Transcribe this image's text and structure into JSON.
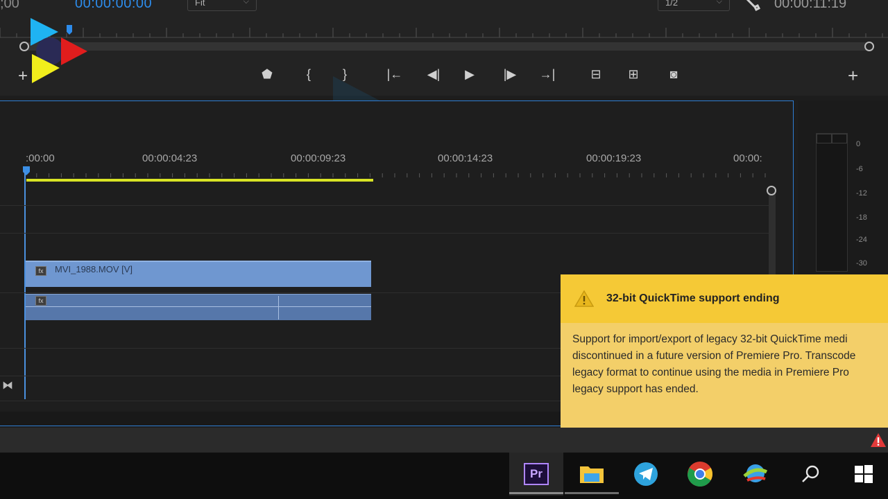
{
  "monitor": {
    "timecode_left": ";00",
    "timecode_current": "00:00:00:00",
    "fit_select": "Fit",
    "resolution_select": "1/2",
    "timecode_duration": "00:00:11:19",
    "transport_icons": [
      "add-marker-icon",
      "mark-in-icon",
      "mark-out-icon",
      "go-to-in-icon",
      "step-back-icon",
      "play-icon",
      "step-forward-icon",
      "go-to-out-icon",
      "lift-icon",
      "extract-icon",
      "export-frame-icon"
    ],
    "transport_glyphs": [
      "⬟",
      "{",
      "}",
      "|←",
      "◀|",
      "▶",
      "|▶",
      "→|",
      "⊟",
      "⊞",
      "◙"
    ]
  },
  "timeline": {
    "ruler_labels": [
      ":00:00",
      "00:00:04:23",
      "00:00:09:23",
      "00:00:14:23",
      "00:00:19:23",
      "00:00:"
    ],
    "clip_video_name": "MVI_1988.MOV [V]",
    "fx_label": "fx"
  },
  "meter": {
    "scale": [
      "0",
      "-6",
      "-12",
      "-18",
      "-24",
      "-30"
    ]
  },
  "notification": {
    "title": "32-bit QuickTime support ending",
    "body_lines": [
      "Support for import/export of legacy 32-bit QuickTime medi",
      "discontinued in a future version of Premiere Pro. Transcode",
      "legacy format to continue using the media in Premiere Pro",
      "legacy support has ended."
    ]
  },
  "taskbar": {
    "apps": [
      "premiere-pro",
      "file-explorer",
      "telegram",
      "chrome",
      "internet-download-manager",
      "search",
      "windows-start"
    ],
    "premiere_label": "Pr"
  },
  "colors": {
    "accent_blue": "#2d8ceb",
    "render_bar": "#d8e325",
    "clip_video": "#6f97d0",
    "clip_audio": "#5677aa",
    "notification_bg": "#f3cf69",
    "notification_header": "#f5c936"
  }
}
